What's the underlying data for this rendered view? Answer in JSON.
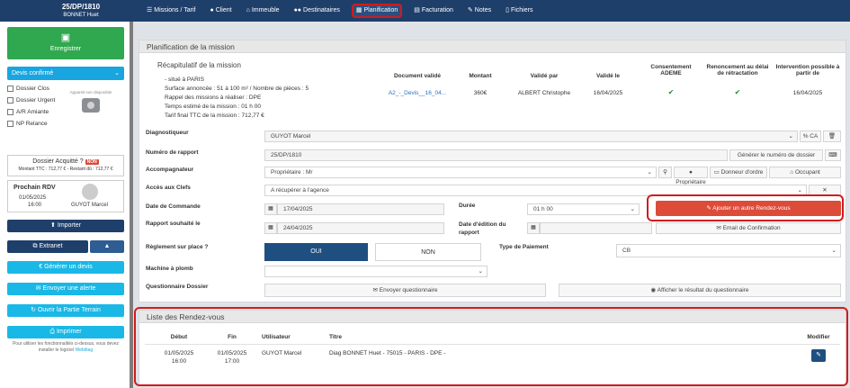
{
  "header": {
    "dossier_ref": "25/DP/1810",
    "dossier_name": "BONNET Huet",
    "nav": [
      {
        "label": "Missions / Tarif",
        "icon": "list-icon"
      },
      {
        "label": "Client",
        "icon": "user-icon"
      },
      {
        "label": "Immeuble",
        "icon": "home-icon"
      },
      {
        "label": "Destinataires",
        "icon": "users-icon"
      },
      {
        "label": "Planification",
        "icon": "calendar-icon",
        "active": true
      },
      {
        "label": "Facturation",
        "icon": "invoice-icon"
      },
      {
        "label": "Notes",
        "icon": "note-icon"
      },
      {
        "label": "Fichiers",
        "icon": "file-icon"
      }
    ]
  },
  "sidebar": {
    "save_label": "Enregistrer",
    "status": "Devis confirmé",
    "checkboxes": [
      "Dossier Clos",
      "Dossier Urgent",
      "A/R Amiante",
      "NP Relance"
    ],
    "camera_caption": "Appareil non disponible",
    "acquitte": {
      "label": "Dossier Acquitté ?",
      "badge": "NON",
      "amounts": "Montant TTC : 712,77 € - Restant dû : 712,77 €"
    },
    "next_rdv": {
      "title": "Prochain RDV",
      "date": "01/05/2025",
      "time": "16:00",
      "user": "GUYOT Marcel"
    },
    "buttons": {
      "import": "Importer",
      "extranet": "Extranet",
      "generate": "Générer un devis",
      "alert": "Envoyer une alerte",
      "terrain": "Ouvrir la Partie Terrain",
      "print": "Imprimer"
    },
    "note": "Pour utiliser les fonctionnalités ci-dessus, vous devez installer le logiciel",
    "note_link": "Webdiag"
  },
  "planif": {
    "title": "Planification de la mission",
    "recap": {
      "title": "Récapitulatif de la mission",
      "lines": [
        "- situé à PARIS",
        "Surface annoncée : 51 à 100 m² / Nombre de pièces : 5",
        "Rappel des missions à réaliser : DPE",
        "Temps estimé de la mission : 01 h 00",
        "Tarif final TTC de la mission : 712,77 €"
      ]
    },
    "table": {
      "headers": [
        "Document validé",
        "Montant",
        "Validé par",
        "Validé le",
        "Consentement ADEME",
        "Renoncement au délai de rétractation",
        "Intervention possible à partir de"
      ],
      "row": {
        "document": "A2_-_Devis__16_04...",
        "montant": "360€",
        "par": "ALBERT Christophe",
        "le": "16/04/2025",
        "ademe": "✔",
        "renonc": "✔",
        "inter": "16/04/2025"
      }
    },
    "fields": {
      "diag_label": "Diagnostiqueur",
      "diag_value": "GUYOT Marcel",
      "ca_label": "% CA",
      "rapport_label": "Numéro de rapport",
      "rapport_value": "25/DP/1810",
      "rapport_btn": "Générer le numéro de dossier",
      "accomp_label": "Accompagnateur",
      "accomp_value": "Propriétaire : Mr",
      "accomp_btns": [
        "Propriétaire",
        "Donneur d'ordre",
        "Occupant"
      ],
      "clefs_label": "Accès aux Clefs",
      "clefs_value": "A récupérer à l'agence",
      "commande_label": "Date de Commande",
      "commande_value": "17/04/2025",
      "duree_label": "Durée",
      "duree_value": "01 h 00",
      "add_rdv": "Ajouter un autre Rendez-vous",
      "souhaite_label": "Rapport souhaité le",
      "souhaite_value": "24/04/2025",
      "edition_label": "Date d'édition du rapport",
      "edition_value": "",
      "email_btn": "Email de Confirmation",
      "reglement_label": "Règlement sur place ?",
      "oui": "OUI",
      "non": "NON",
      "paiement_label": "Type de Paiement",
      "paiement_value": "CB",
      "machine_label": "Machine à plomb",
      "machine_value": "",
      "quest_label": "Questionnaire Dossier",
      "quest_send": "Envoyer questionnaire",
      "quest_show": "Afficher le résultat du questionnaire"
    }
  },
  "liste": {
    "title": "Liste des Rendez-vous",
    "headers": [
      "Début",
      "Fin",
      "Utilisateur",
      "Titre",
      "Modifier"
    ],
    "rows": [
      {
        "debut_date": "01/05/2025",
        "debut_time": "16:00",
        "fin_date": "01/05/2025",
        "fin_time": "17:00",
        "user": "GUYOT Marcel",
        "titre": "Diag BONNET Huet - 75015 - PARIS - DPE -"
      }
    ]
  }
}
